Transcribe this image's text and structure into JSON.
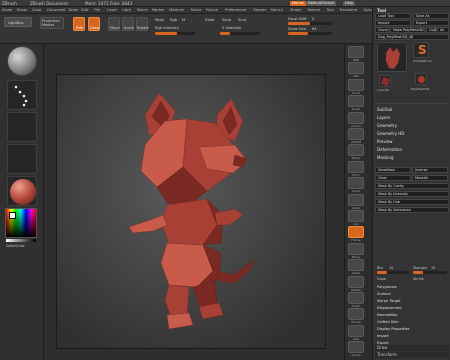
{
  "titlebar": {
    "app": "ZBrush",
    "doc": "ZBrush Document",
    "info": "Mem: 1471 Free: 2843",
    "menus_btn": "Menus",
    "script_btn": "DefaultZScript",
    "help_btn": "Help"
  },
  "menubar": {
    "items": [
      "Alpha",
      "Brush",
      "Color",
      "Document",
      "Draw",
      "Edit",
      "File",
      "Layer",
      "Light",
      "Macro",
      "Marker",
      "Material",
      "Movie",
      "Picture",
      "Preferences",
      "Render",
      "Stencil",
      "Stroke",
      "Texture",
      "Tool",
      "Transform",
      "Zplugin",
      "Zscript"
    ]
  },
  "shelf": {
    "lightbox": "LightBox",
    "projection": "Projection Master",
    "edit": "Edit",
    "draw": "Draw",
    "move": "Move",
    "scale": "Scale",
    "rotate": "Rotate",
    "mrgb": "Mrgb",
    "rgb": "Rgb",
    "m": "M",
    "zadd": "Zadd",
    "zsub": "Zsub",
    "zcut": "Zcut",
    "focal_label": "Focal Shift",
    "focal_value": "0",
    "draw_size_label": "Draw Size",
    "draw_size_value": "64",
    "z_intensity": "Z Intensity",
    "rgb_intensity": "Rgb Intensity",
    "focal_fill": 0.5,
    "draw_fill": 0.45,
    "zint_fill": 0.25,
    "rgb_fill": 0.55
  },
  "lefttray": {
    "switch_label": "SwitchColor",
    "gradient_label": "Gradient",
    "material_color": "#b5483c"
  },
  "model": {
    "color": "#a84035",
    "shade": "#7a2a22",
    "light": "#c95b4a"
  },
  "righttools": {
    "labels": [
      "BPR",
      "SPix",
      "Scroll",
      "Zoom",
      "Actual",
      "AAHalf",
      "Persp",
      "Floor",
      "Local",
      "LSym",
      "Xyz",
      "Frame",
      "Move",
      "Scale",
      "Rotate",
      "PolyF",
      "Transp",
      "Solo",
      "Xpose"
    ]
  },
  "palette": {
    "header": "Tool",
    "load_tool": "Load Tool",
    "save_as": "Save As",
    "import": "Import",
    "export": "Export",
    "clone": "Clone",
    "make_polymesh": "Make PolyMesh3D",
    "goz": "GoZ",
    "all": "All",
    "visible": "Visible",
    "current_tool": "Dog_PolyMesh3D_48",
    "subtools": [
      "Dog_PolyMesh",
      "SimpleBrush",
      "Cube3D",
      "PolyMesh3D"
    ],
    "sections": [
      "SubTool",
      "Layers",
      "Geometry",
      "Geometry HD",
      "Preview",
      "Deformation",
      "Masking"
    ],
    "masking_rows": [
      "ViewMask",
      "Inverse",
      "Clear",
      "MaskAll",
      "Mask By Cavity",
      "Mask By Intensity",
      "Mask By Hue",
      "Mask By Saturation"
    ],
    "blur_label": "Blur",
    "blur_value": "10",
    "sharpen_label": "Sharpen",
    "sharpen_value": "10",
    "grow": "Grow",
    "shrink": "Shrink",
    "bottom_sections": [
      "Polygroups",
      "Surface",
      "Morph Target",
      "Displacement",
      "NormalMap",
      "Unified Skin",
      "Display Properties",
      "Import",
      "Export"
    ],
    "draw_label": "Draw",
    "transform_label": "Transform"
  },
  "colors": {
    "accent": "#d9661e",
    "panel": "#333333",
    "canvas": "#4a4a4a"
  }
}
